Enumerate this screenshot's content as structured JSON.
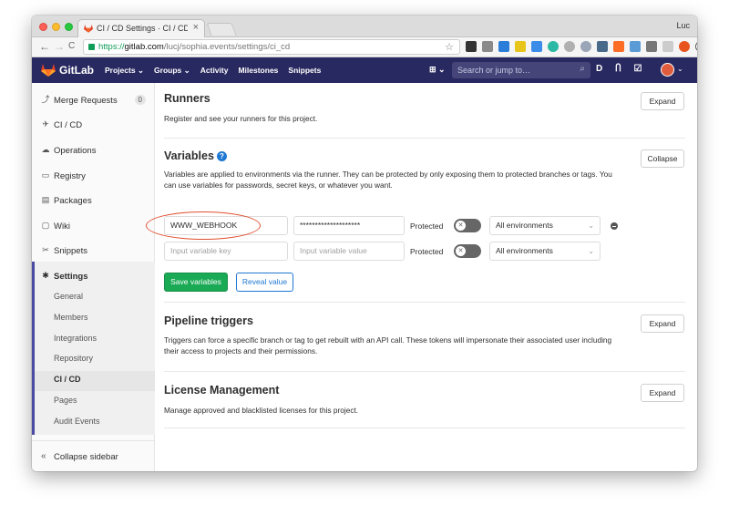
{
  "browser": {
    "tab_title": "CI / CD Settings · CI / CD · Luc",
    "tab_close": "×",
    "profile": "Luc",
    "url_scheme": "https://",
    "url_host": "gitlab.com",
    "url_path": "/lucj/sophia.events/settings/ci_cd",
    "nav_back": "←",
    "nav_forward": "→",
    "nav_reload": "C",
    "star": "☆"
  },
  "gitlab_nav": {
    "brand": "GitLab",
    "menu": [
      "Projects ⌄",
      "Groups ⌄",
      "Activity",
      "Milestones",
      "Snippets"
    ],
    "plus": "⊞ ⌄",
    "search_placeholder": "Search or jump to…",
    "search_icon": "⌕",
    "right_icons": [
      "D",
      "Ⴖ",
      "☑"
    ],
    "avatar_caret": "⌄"
  },
  "sidebar": {
    "items": [
      {
        "label": "Merge Requests",
        "icon": "merge-request-icon",
        "glyph": "⤴",
        "count": "0"
      },
      {
        "label": "CI / CD",
        "icon": "rocket-icon",
        "glyph": "✈"
      },
      {
        "label": "Operations",
        "icon": "cloud-gear-icon",
        "glyph": "☁"
      },
      {
        "label": "Registry",
        "icon": "container-icon",
        "glyph": "▭"
      },
      {
        "label": "Packages",
        "icon": "package-icon",
        "glyph": "▤"
      },
      {
        "label": "Wiki",
        "icon": "book-icon",
        "glyph": "▢"
      },
      {
        "label": "Snippets",
        "icon": "scissors-icon",
        "glyph": "✂"
      },
      {
        "label": "Settings",
        "icon": "gear-icon",
        "glyph": "✱"
      }
    ],
    "settings_sub": [
      "General",
      "Members",
      "Integrations",
      "Repository",
      "CI / CD",
      "Pages",
      "Audit Events"
    ],
    "collapse_label": "Collapse sidebar",
    "collapse_glyph": "«"
  },
  "runners": {
    "title": "Runners",
    "description": "Register and see your runners for this project.",
    "button": "Expand"
  },
  "variables": {
    "title": "Variables",
    "help_glyph": "?",
    "description": "Variables are applied to environments via the runner. They can be protected by only exposing them to protected branches or tags. You can use variables for passwords, secret keys, or whatever you want.",
    "button": "Collapse",
    "rows": [
      {
        "key": "WWW_WEBHOOK",
        "value": "********************",
        "protected_label": "Protected",
        "environment": "All environments"
      },
      {
        "key_placeholder": "Input variable key",
        "value_placeholder": "Input variable value",
        "protected_label": "Protected",
        "environment": "All environments"
      }
    ],
    "toggle_glyph": "✕",
    "save_button": "Save variables",
    "reveal_button": "Reveal value"
  },
  "pipeline_triggers": {
    "title": "Pipeline triggers",
    "description": "Triggers can force a specific branch or tag to get rebuilt with an API call. These tokens will impersonate their associated user including their access to projects and their permissions.",
    "button": "Expand"
  },
  "license_management": {
    "title": "License Management",
    "description": "Manage approved and blacklisted licenses for this project.",
    "button": "Expand"
  },
  "colors": {
    "navbar": "#292961",
    "save_green": "#1aaa55",
    "link_blue": "#1f78d1",
    "highlight": "#e04f2f"
  }
}
